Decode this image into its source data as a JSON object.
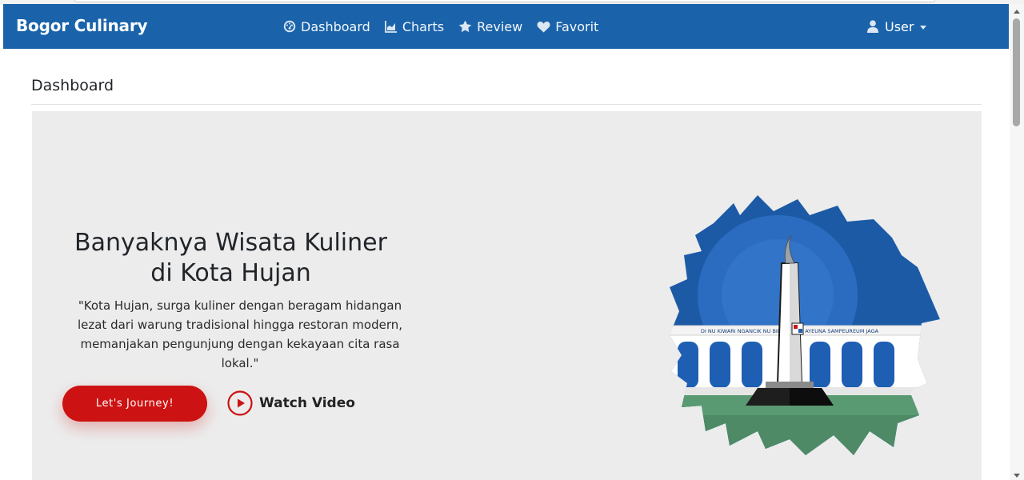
{
  "navbar": {
    "brand": "Bogor Culinary",
    "links": [
      {
        "label": "Dashboard",
        "icon": "dashboard-gauge-icon"
      },
      {
        "label": "Charts",
        "icon": "area-chart-icon"
      },
      {
        "label": "Review",
        "icon": "star-icon"
      },
      {
        "label": "Favorit",
        "icon": "heart-icon"
      }
    ],
    "user_label": "User"
  },
  "page": {
    "title": "Dashboard"
  },
  "hero": {
    "heading_line1": "Banyaknya Wisata Kuliner",
    "heading_line2": "di Kota Hujan",
    "description": "\"Kota Hujan, surga kuliner dengan beragam hidangan lezat dari warung tradisional hingga restoran modern, memanjakan pengunjung dengan kekayaan cita rasa lokal.\"",
    "cta_label": "Let's Journey!",
    "video_label": "Watch Video",
    "illustration_banner": "DI NU KIWARI NGANCIK NU BIHARI SEJA AYEUNA SAMPEUREUM JAGA"
  },
  "colors": {
    "navbar": "#1a63aa",
    "cta": "#cc1212",
    "hero_bg": "#ececec"
  }
}
